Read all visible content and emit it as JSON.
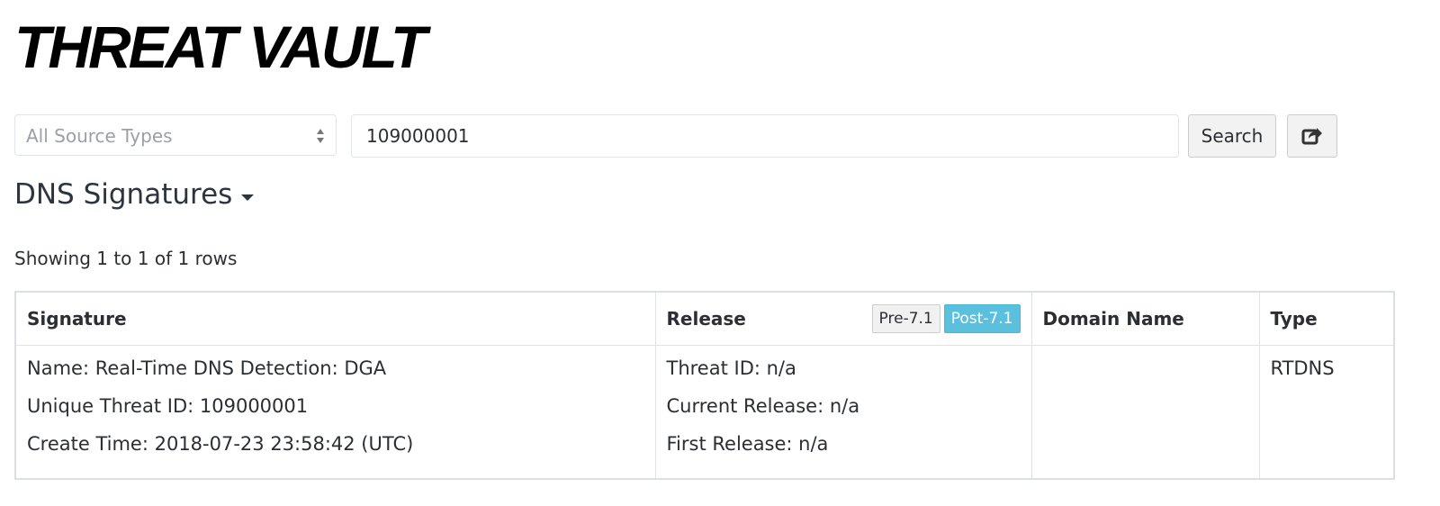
{
  "header": {
    "logo_text": "THREAT VAULT"
  },
  "search": {
    "source_select_value": "All Source Types",
    "query_value": "109000001",
    "search_label": "Search",
    "share_icon": "share-icon"
  },
  "section": {
    "title": "DNS Signatures"
  },
  "table": {
    "row_count_text": "Showing 1 to 1 of 1 rows",
    "columns": {
      "signature": "Signature",
      "release": "Release",
      "domain": "Domain Name",
      "type": "Type"
    },
    "release_toggle": {
      "pre": "Pre-7.1",
      "post": "Post-7.1",
      "active": "post"
    },
    "rows": [
      {
        "name": "Name: Real-Time DNS Detection: DGA",
        "unique_id": "Unique Threat ID: 109000001",
        "create_time": "Create Time: 2018-07-23 23:58:42 (UTC)",
        "threat_id": "Threat ID: n/a",
        "current_release": "Current Release: n/a",
        "first_release": "First Release: n/a",
        "domain": "",
        "type": "RTDNS"
      }
    ]
  },
  "colors": {
    "accent": "#5bc0de",
    "text": "#2b2f33"
  }
}
